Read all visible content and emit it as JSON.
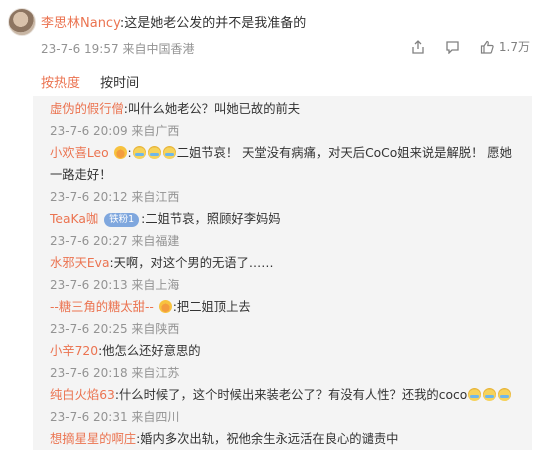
{
  "post": {
    "username": "李思林Nancy",
    "text": ":这是她老公发的并不是我准备的",
    "time": "23-7-6 19:57",
    "source": "来自中国香港",
    "likes": "1.7万"
  },
  "tabs": [
    "按热度",
    "按时间"
  ],
  "replies": [
    {
      "name": "虚伪的假行僧",
      "text": ":叫什么她老公？叫她已故的前夫",
      "meta": "23-7-6 20:09 来自广西"
    },
    {
      "name": "小欢喜Leo",
      "text_a": "二姐节哀！ 天堂没有病痛，对天后CoCo姐来说是解脱！ 愿她",
      "text_b": "一路走好！",
      "meta": "23-7-6 20:12 来自江西"
    },
    {
      "name": "TeaKa咖",
      "badge": "铁粉1",
      "text": ":二姐节哀，照顾好李妈妈",
      "meta": "23-7-6 20:27 来自福建"
    },
    {
      "name": "水邪天Eva",
      "text": ":天啊，对这个男的无语了……",
      "meta": "23-7-6 20:13 来自上海"
    },
    {
      "name": "--糖三角的糖太甜--",
      "text": ":把二姐顶上去",
      "meta": "23-7-6 20:25 来自陕西"
    },
    {
      "name": "小辛720",
      "text": ":他怎么还好意思的",
      "meta": "23-7-6 20:18 来自江苏"
    },
    {
      "name": "纯白火焰63",
      "text": ":什么时候了，这个时候出来装老公了？有没有人性？还我的coco",
      "meta": "23-7-6 20:31 来自四川"
    },
    {
      "name": "想摘星星的啊庄",
      "text": ":婚内多次出轨，祝他余生永远活在良心的谴责中"
    }
  ]
}
